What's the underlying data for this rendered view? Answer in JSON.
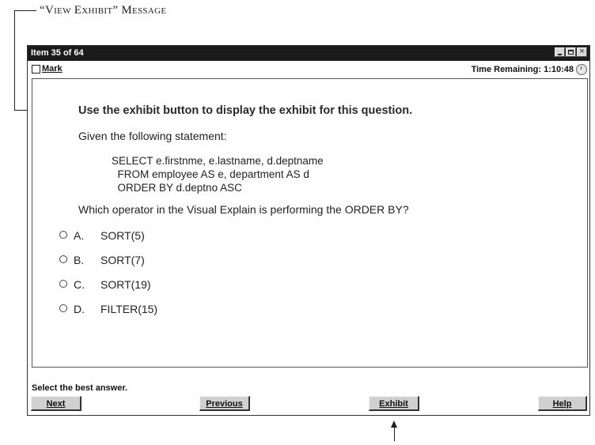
{
  "annotation": {
    "view_exhibit_label": "“View Exhibit” Message"
  },
  "window": {
    "title": "Item 35 of 64",
    "mark_label": "Mark",
    "time_label": "Time Remaining: 1:10:48",
    "icons": [
      "minimize-icon",
      "maximize-icon",
      "close-icon",
      "clock-icon"
    ]
  },
  "question": {
    "intro": "Use the exhibit button to display the exhibit for this question.",
    "given": "Given the following statement:",
    "code_lines": [
      "SELECT e.firstnme, e.lastname, d.deptname",
      "  FROM employee AS e, department AS d",
      "  ORDER BY d.deptno ASC"
    ],
    "prompt": "Which operator in the Visual Explain is performing the ORDER BY?"
  },
  "options": [
    {
      "letter": "A.",
      "text": "SORT(5)"
    },
    {
      "letter": "B.",
      "text": "SORT(7)"
    },
    {
      "letter": "C.",
      "text": "SORT(19)"
    },
    {
      "letter": "D.",
      "text": "FILTER(15)"
    }
  ],
  "footer": {
    "instruction": "Select the best answer.",
    "next": "Next",
    "previous": "Previous",
    "exhibit": "Exhibit",
    "help": "Help"
  }
}
